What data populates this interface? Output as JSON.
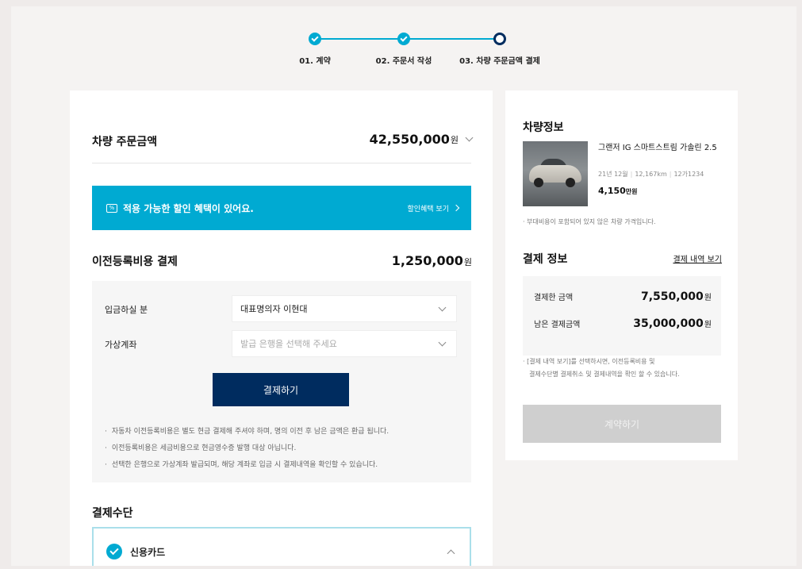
{
  "stepper": {
    "steps": [
      {
        "label": "01. 계약",
        "state": "done"
      },
      {
        "label": "02. 주문서 작성",
        "state": "done"
      },
      {
        "label": "03. 차량 주문금액 결제",
        "state": "current"
      }
    ]
  },
  "order_amount": {
    "title": "차량 주문금액",
    "value": "42,550,000",
    "unit": "원"
  },
  "discount_banner": {
    "text": "적용 가능한 할인 혜택이 있어요.",
    "icon_text": "%",
    "link": "할인혜택 보기"
  },
  "transfer": {
    "title": "이전등록비용 결제",
    "value": "1,250,000",
    "unit": "원",
    "depositor_label": "입금하실 분",
    "depositor_value": "대표명의자 이현대",
    "account_label": "가상계좌",
    "account_placeholder": "발급 은행을 선택해 주세요",
    "pay_button": "결제하기",
    "notes": [
      "자동차 이전등록비용은 별도 현금 결제해 주셔야 하며, 명의 이전 후 남은 금액은 환급 됩니다.",
      "이전등록비용은 세금비용으로 현금영수증 발행 대상 아닙니다.",
      "선택한 은행으로 가상계좌 발급되며, 해당 계좌로 입금 시 결제내역을 확인할 수 있습니다."
    ]
  },
  "payment_method": {
    "title": "결제수단",
    "selected": "신용카드"
  },
  "vehicle": {
    "title": "차량정보",
    "name": "그랜저 IG 스마트스트림 가솔린 2.5",
    "year": "21년 12월",
    "mileage": "12,167km",
    "plate": "12가1234",
    "price": "4,150",
    "price_unit": "만원",
    "note": "부대비용이 포함되어 있지 않은 차량 가격입니다."
  },
  "payment_info": {
    "title": "결제 정보",
    "history_link": "결제 내역 보기",
    "paid_label": "결제한 금액",
    "paid_value": "7,550,000",
    "remain_label": "남은 결제금액",
    "remain_value": "35,000,000",
    "unit": "원",
    "note_line1": "[결제 내역 보기]를 선택하시면, 이전등록비용 및",
    "note_line2": "결제수단별 결제취소 및 결제내역을 확인 할 수 있습니다.",
    "contract_button": "계약하기"
  },
  "colors": {
    "accent": "#00aad2",
    "navy": "#002c5f",
    "disabled": "#cfcfcf"
  }
}
